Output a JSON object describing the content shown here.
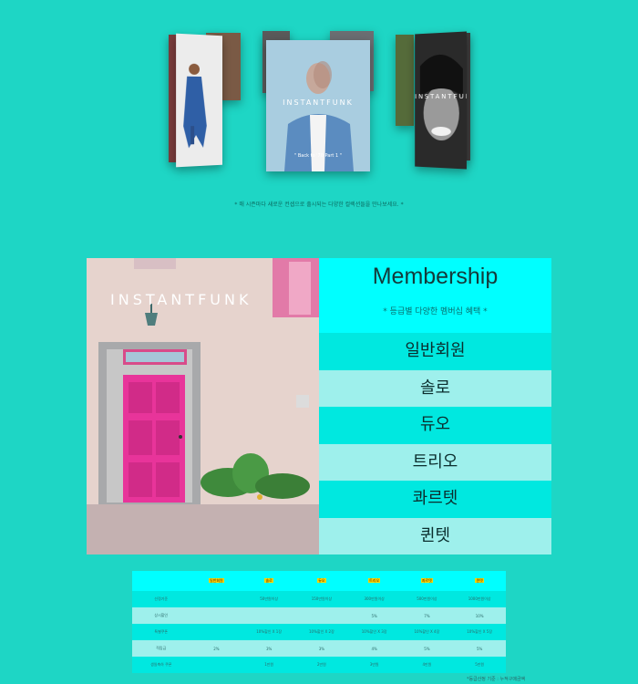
{
  "gallery": {
    "center_brand": "INSTANTFUNK",
    "center_caption": "\" Back to '70 Part 1 \"",
    "right_brand": "INSTANTFUNK"
  },
  "caption": "* 매 시즌마다 새로운 컨셉으로 출시되는 다양한 컬렉션들을 만나보세요. *",
  "photo_brand": "INSTANTFUNK",
  "membership": {
    "title": "Membership",
    "subtitle": "* 등급별 다양한 멤버십 혜택 *",
    "tiers": [
      "일반회원",
      "솔로",
      "듀오",
      "트리오",
      "콰르텟",
      "퀸텟"
    ]
  },
  "table": {
    "headers": [
      "",
      "일반회원",
      "솔로",
      "듀오",
      "트리오",
      "콰르텟",
      "퀸텟"
    ],
    "rows": [
      [
        "선정기준",
        "",
        "50만원이상",
        "150만원이상",
        "300만원이상",
        "500만원이상",
        "1000만원이상"
      ],
      [
        "상시할인",
        "",
        "",
        "",
        "5%",
        "7%",
        "10%"
      ],
      [
        "특별쿠폰",
        "",
        "10%할인 X 1장",
        "10%할인 X 2장",
        "10%할인 X 3장",
        "10%할인 X 4장",
        "10%할인 X 5장"
      ],
      [
        "적립금",
        "2%",
        "3%",
        "3%",
        "4%",
        "5%",
        "5%"
      ],
      [
        "생일축하 쿠폰",
        "",
        "1만원",
        "2만원",
        "3만원",
        "4만원",
        "5만원"
      ]
    ],
    "footnote": "*등급산정 기준 : 누적구매금액"
  },
  "colors": {
    "background": "#1ed6c5",
    "cyan": "#00ffff",
    "row_dark": "#00e8e0",
    "row_light": "#9ef0ec",
    "door_pink": "#e8349a"
  }
}
